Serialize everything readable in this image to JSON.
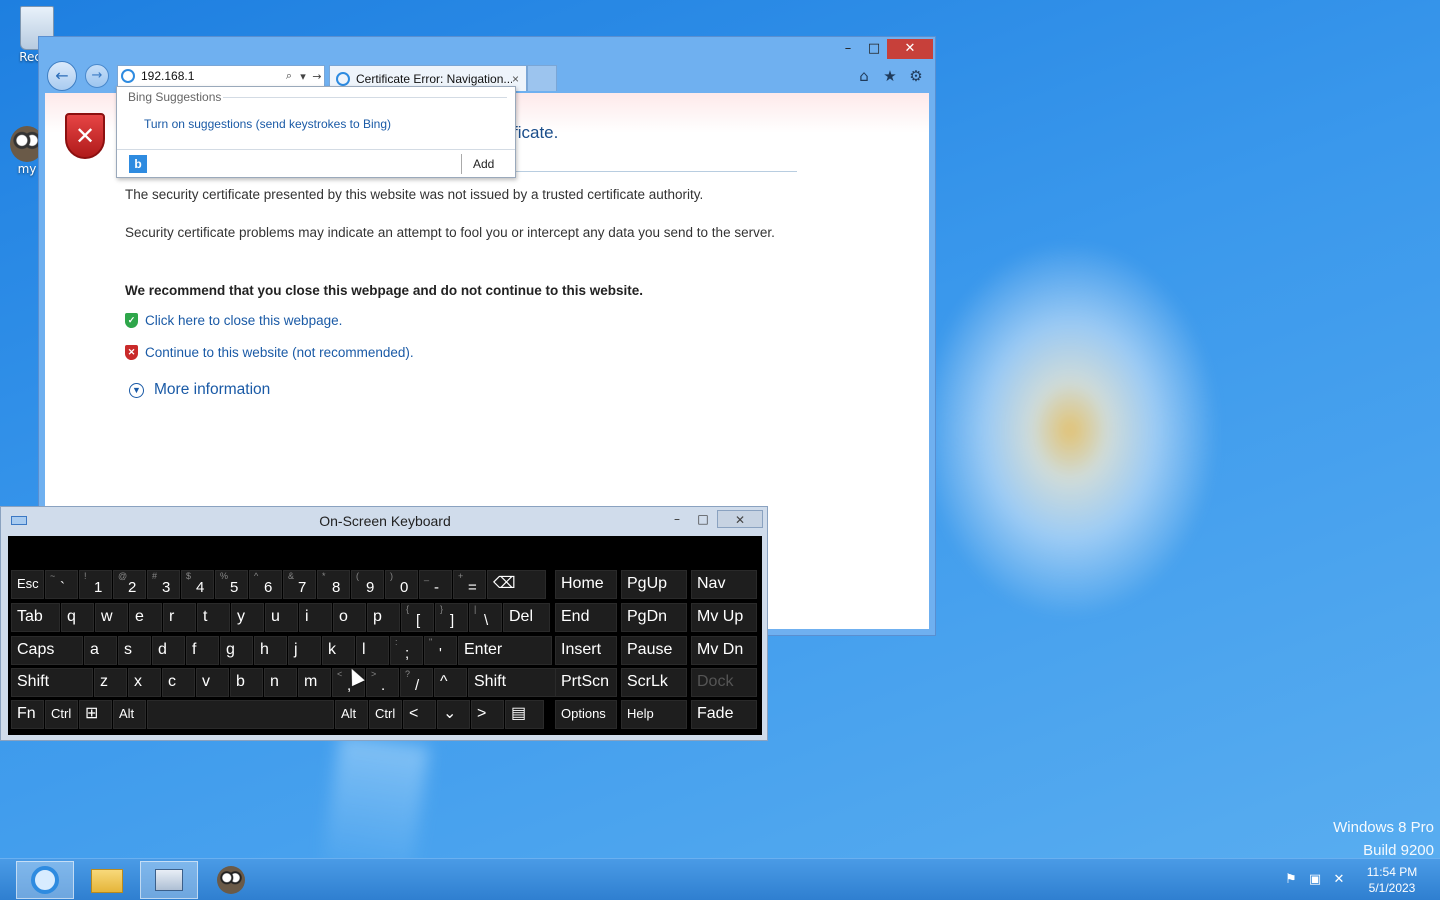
{
  "desktop": {
    "icons": [
      {
        "label": "Recyc",
        "name": "recycle-bin"
      },
      {
        "label": "my",
        "name": "my-raccoon"
      }
    ],
    "watermark": {
      "line1": "Windows 8 Pro",
      "line2": "Build 9200"
    }
  },
  "ie": {
    "address": "192.168.1",
    "tab_title": "Certificate Error: Navigation...",
    "tab_close": "×",
    "window_controls": {
      "minimize": "–",
      "maximize": "□",
      "close": "✕"
    },
    "nav": {
      "back": "←",
      "forward": "→"
    },
    "address_icons": {
      "search": "⌕",
      "dropdown": "▾",
      "go": "→"
    },
    "command_icons": {
      "home": "⌂",
      "favorites": "★",
      "tools": "⚙"
    },
    "bing": {
      "header": "Bing Suggestions",
      "turn_on": "Turn on suggestions (send keystrokes to Bing)",
      "logo": "b",
      "add": "Add"
    },
    "page": {
      "title_fragment": "ficate.",
      "para1": "The security certificate presented by this website was not issued by a trusted certificate authority.",
      "para2": "Security certificate problems may indicate an attempt to fool you or intercept any data you send to the server.",
      "para3": "We recommend that you close this webpage and do not continue to this website.",
      "link_close": "Click here to close this webpage.",
      "link_continue": "Continue to this website (not recommended).",
      "more_info": "More information"
    }
  },
  "osk": {
    "title": "On-Screen Keyboard",
    "controls": {
      "minimize": "–",
      "maximize": "□",
      "close": "✕"
    },
    "rows": [
      [
        {
          "shift": "",
          "label": "Esc"
        },
        {
          "shift": "~",
          "label": "`"
        },
        {
          "shift": "!",
          "label": "1"
        },
        {
          "shift": "@",
          "label": "2"
        },
        {
          "shift": "#",
          "label": "3"
        },
        {
          "shift": "$",
          "label": "4"
        },
        {
          "shift": "%",
          "label": "5"
        },
        {
          "shift": "^",
          "label": "6"
        },
        {
          "shift": "&",
          "label": "7"
        },
        {
          "shift": "*",
          "label": "8"
        },
        {
          "shift": "(",
          "label": "9"
        },
        {
          "shift": ")",
          "label": "0"
        },
        {
          "shift": "_",
          "label": "-"
        },
        {
          "shift": "+",
          "label": "="
        },
        {
          "shift": "",
          "label": "⌫"
        }
      ],
      [
        {
          "shift": "",
          "label": "Tab"
        },
        {
          "shift": "",
          "label": "q"
        },
        {
          "shift": "",
          "label": "w"
        },
        {
          "shift": "",
          "label": "e"
        },
        {
          "shift": "",
          "label": "r"
        },
        {
          "shift": "",
          "label": "t"
        },
        {
          "shift": "",
          "label": "y"
        },
        {
          "shift": "",
          "label": "u"
        },
        {
          "shift": "",
          "label": "i"
        },
        {
          "shift": "",
          "label": "o"
        },
        {
          "shift": "",
          "label": "p"
        },
        {
          "shift": "{",
          "label": "["
        },
        {
          "shift": "}",
          "label": "]"
        },
        {
          "shift": "|",
          "label": "\\"
        },
        {
          "shift": "",
          "label": "Del"
        }
      ],
      [
        {
          "shift": "",
          "label": "Caps"
        },
        {
          "shift": "",
          "label": "a"
        },
        {
          "shift": "",
          "label": "s"
        },
        {
          "shift": "",
          "label": "d"
        },
        {
          "shift": "",
          "label": "f"
        },
        {
          "shift": "",
          "label": "g"
        },
        {
          "shift": "",
          "label": "h"
        },
        {
          "shift": "",
          "label": "j"
        },
        {
          "shift": "",
          "label": "k"
        },
        {
          "shift": "",
          "label": "l"
        },
        {
          "shift": ":",
          "label": ";"
        },
        {
          "shift": "\"",
          "label": "'"
        },
        {
          "shift": "",
          "label": "Enter"
        }
      ],
      [
        {
          "shift": "",
          "label": "Shift"
        },
        {
          "shift": "",
          "label": "z"
        },
        {
          "shift": "",
          "label": "x"
        },
        {
          "shift": "",
          "label": "c"
        },
        {
          "shift": "",
          "label": "v"
        },
        {
          "shift": "",
          "label": "b"
        },
        {
          "shift": "",
          "label": "n"
        },
        {
          "shift": "",
          "label": "m"
        },
        {
          "shift": "<",
          "label": ","
        },
        {
          "shift": ">",
          "label": "."
        },
        {
          "shift": "?",
          "label": "/"
        },
        {
          "shift": "",
          "label": "^"
        },
        {
          "shift": "",
          "label": "Shift"
        }
      ],
      [
        {
          "shift": "",
          "label": "Fn"
        },
        {
          "shift": "",
          "label": "Ctrl"
        },
        {
          "shift": "",
          "label": "⊞"
        },
        {
          "shift": "",
          "label": "Alt"
        },
        {
          "shift": "",
          "label": ""
        },
        {
          "shift": "",
          "label": "Alt"
        },
        {
          "shift": "",
          "label": "Ctrl"
        },
        {
          "shift": "",
          "label": "<"
        },
        {
          "shift": "",
          "label": "⌄"
        },
        {
          "shift": "",
          "label": ">"
        },
        {
          "shift": "",
          "label": "▤"
        }
      ]
    ],
    "nav_keys": [
      [
        "Home",
        "PgUp",
        "Nav"
      ],
      [
        "End",
        "PgDn",
        "Mv Up"
      ],
      [
        "Insert",
        "Pause",
        "Mv Dn"
      ],
      [
        "PrtScn",
        "ScrLk",
        "Dock"
      ],
      [
        "Options",
        "Help",
        "Fade"
      ]
    ]
  },
  "taskbar": {
    "apps": [
      {
        "name": "internet-explorer",
        "active": true
      },
      {
        "name": "file-explorer",
        "active": false
      },
      {
        "name": "on-screen-keyboard",
        "active": true
      },
      {
        "name": "raccoon-app",
        "active": false
      }
    ],
    "tray_icons": [
      "action-center-flag-icon",
      "network-icon",
      "volume-muted-icon"
    ],
    "time": "11:54 PM",
    "date": "5/1/2023"
  }
}
